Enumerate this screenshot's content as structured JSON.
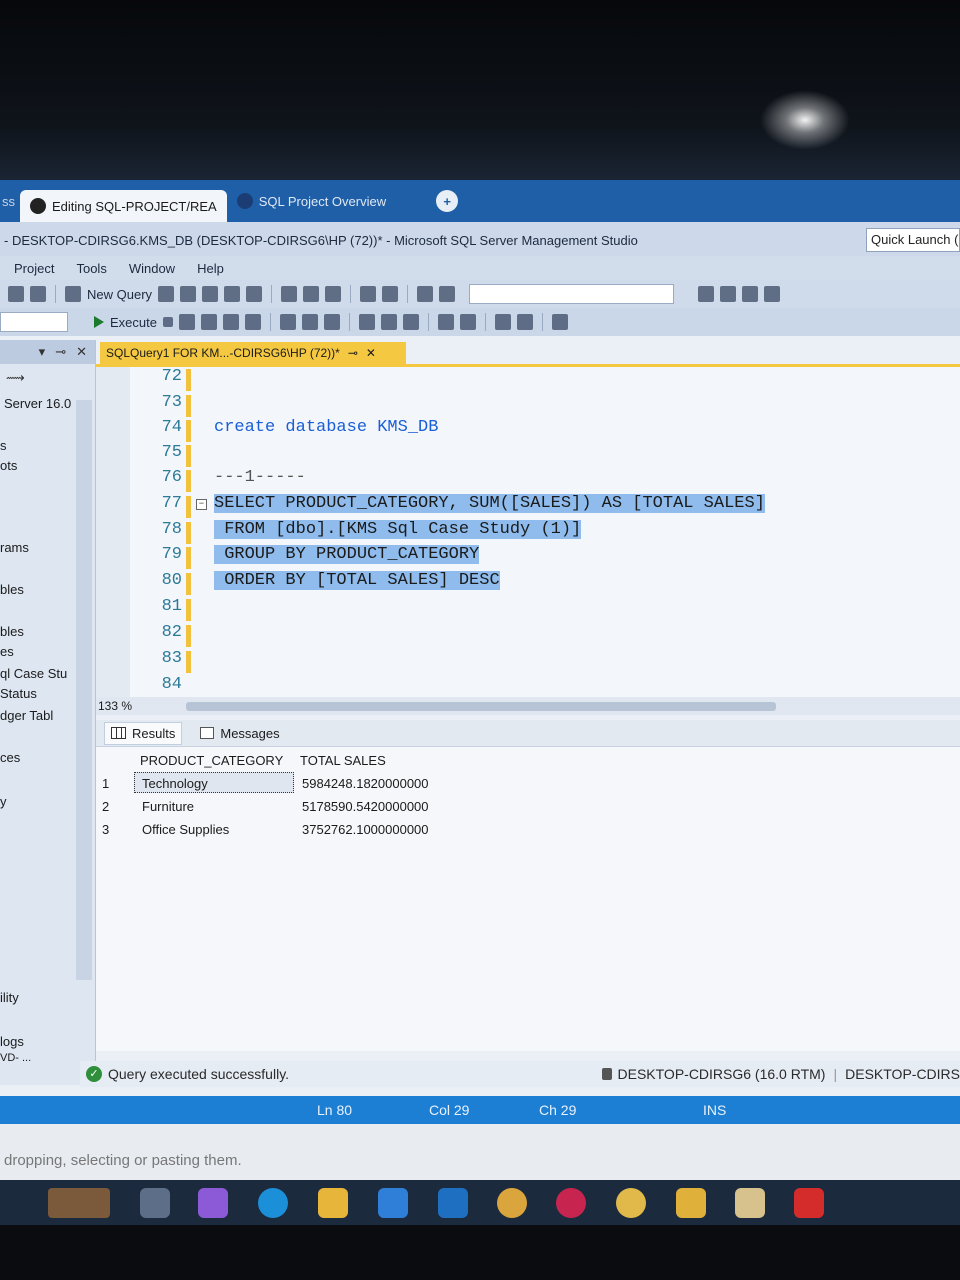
{
  "browser_tabs": {
    "lead": "ss",
    "tab1": "Editing SQL-PROJECT/REA",
    "tab2": "SQL Project Overview",
    "new_tab": "+"
  },
  "window": {
    "title": "- DESKTOP-CDIRSG6.KMS_DB (DESKTOP-CDIRSG6\\HP (72))* - Microsoft SQL Server Management Studio",
    "quick_launch": "Quick Launch ("
  },
  "menu": [
    "Project",
    "Tools",
    "Window",
    "Help"
  ],
  "toolbar": {
    "new_query": "New Query",
    "execute": "Execute"
  },
  "sidebar": {
    "server": "Server 16.0",
    "items": [
      "s",
      "ots",
      "rams",
      "bles",
      "bles",
      "es",
      "ql Case Stu",
      "Status",
      "dger Tabl",
      "ces",
      "y",
      "ility",
      "logs",
      "VD- ..."
    ]
  },
  "editor_tab": {
    "label": "SQLQuery1 FOR KM...-CDIRSG6\\HP (72))*",
    "pin": "⊸",
    "close": "✕"
  },
  "editor": {
    "lines": [
      {
        "n": "72",
        "text": ""
      },
      {
        "n": "73",
        "text": ""
      },
      {
        "n": "74",
        "text": "create database KMS_DB"
      },
      {
        "n": "75",
        "text": ""
      },
      {
        "n": "76",
        "text": "---1-----"
      },
      {
        "n": "77",
        "text": "SELECT PRODUCT_CATEGORY, SUM([SALES]) AS [TOTAL SALES]"
      },
      {
        "n": "78",
        "text": " FROM [dbo].[KMS Sql Case Study (1)]"
      },
      {
        "n": "79",
        "text": " GROUP BY PRODUCT_CATEGORY"
      },
      {
        "n": "80",
        "text": " ORDER BY [TOTAL SALES] DESC"
      },
      {
        "n": "81",
        "text": ""
      },
      {
        "n": "82",
        "text": ""
      },
      {
        "n": "83",
        "text": ""
      },
      {
        "n": "84",
        "text": ""
      }
    ],
    "zoom": "133 %"
  },
  "results": {
    "tabs": [
      "Results",
      "Messages"
    ],
    "columns": [
      "PRODUCT_CATEGORY",
      "TOTAL SALES"
    ],
    "rows": [
      {
        "n": "1",
        "category": "Technology",
        "total": "5984248.1820000000"
      },
      {
        "n": "2",
        "category": "Furniture",
        "total": "5178590.5420000000"
      },
      {
        "n": "3",
        "category": "Office Supplies",
        "total": "3752762.1000000000"
      }
    ]
  },
  "status": {
    "message": "Query executed successfully.",
    "server": "DESKTOP-CDIRSG6 (16.0 RTM)",
    "server2": "DESKTOP-CDIRS",
    "ln": "Ln 80",
    "col": "Col 29",
    "ch": "Ch 29",
    "mode": "INS"
  },
  "hint": "dropping, selecting or pasting them."
}
